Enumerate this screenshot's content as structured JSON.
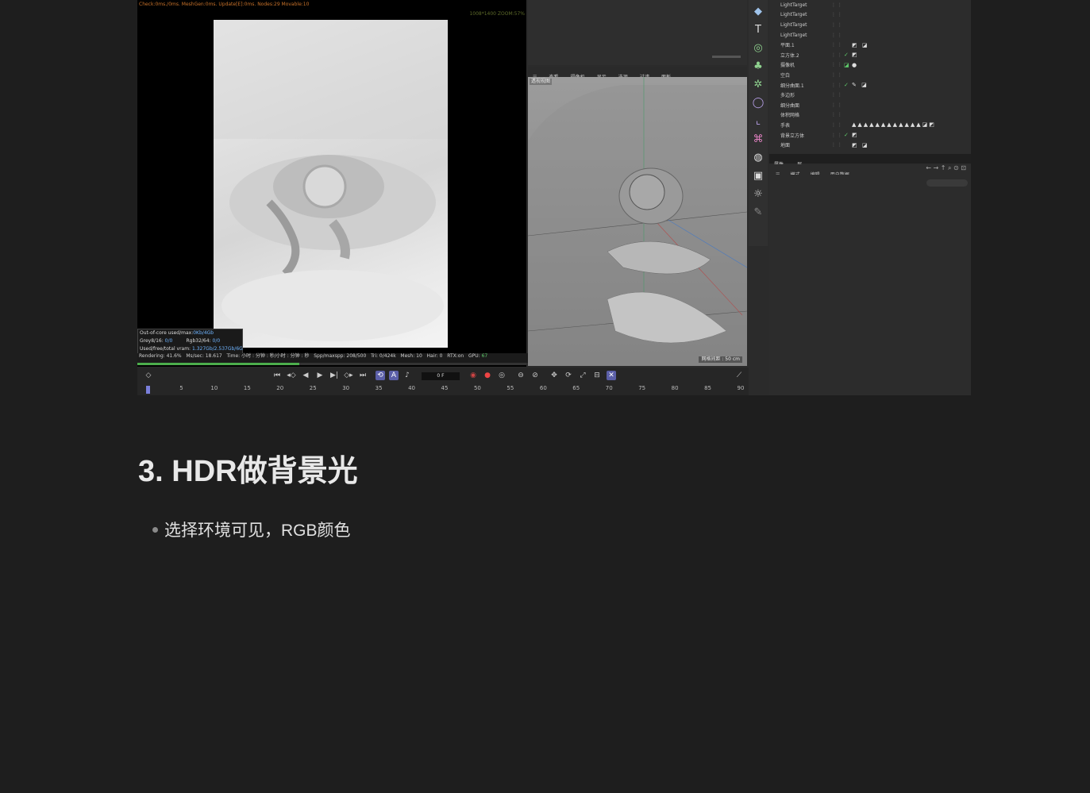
{
  "render_view": {
    "info_line": "Check:0ms./0ms. MeshGen:0ms. Update[E]:0ms. Nodes:29 Movable:10",
    "zoom_line": "1008*1400 ZOOM:57%",
    "stats": [
      {
        "label": "Out-of-core used/max:",
        "value": "0Kb/4Gb"
      },
      {
        "label": "Grey8/16:",
        "value": "0/0",
        "label2": "Rgb32/64:",
        "value2": "0/0"
      },
      {
        "label": "Used/free/total vram:",
        "value": "1.327Gb/2.537Gb/6G"
      }
    ],
    "status": {
      "rendering": "Rendering: 41.6%",
      "ms_sec": "Ms/sec: 18.617",
      "time": "Time: 小时 : 分钟 : 秒/小时 : 分钟 : 秒",
      "spp": "Spp/maxspp: 208/500",
      "tri": "Tri: 0/424k",
      "mesh": "Mesh: 10",
      "hair": "Hair: 0",
      "rtx": "RTX:on",
      "gpu": "GPU:",
      "gpu_val": "67"
    },
    "progress": 0.416
  },
  "viewport": {
    "menu": [
      "查看",
      "摄像机",
      "显示",
      "选项",
      "过滤",
      "面板"
    ],
    "camera_label": "透视视图",
    "scale": "网格间距 : 50 cm"
  },
  "objects": [
    {
      "name": "LightTarget",
      "check": "",
      "tags": ""
    },
    {
      "name": "LightTarget",
      "check": "",
      "tags": ""
    },
    {
      "name": "LightTarget",
      "check": "",
      "tags": ""
    },
    {
      "name": "LightTarget",
      "check": "",
      "tags": ""
    },
    {
      "name": "平面.1",
      "check": "",
      "tags": "◩ ◪"
    },
    {
      "name": "立方体.2",
      "check": "✓",
      "tags": "◩"
    },
    {
      "name": "摄像机",
      "check": "◪",
      "tags": "●"
    },
    {
      "name": "空白",
      "check": "",
      "tags": ""
    },
    {
      "name": "细分曲面.1",
      "check": "✓",
      "tags": "✎ ◪"
    },
    {
      "name": "多边形",
      "check": "",
      "tags": ""
    },
    {
      "name": "细分曲面",
      "check": "",
      "tags": ""
    },
    {
      "name": "体积网格",
      "check": "",
      "tags": ""
    },
    {
      "name": "手表",
      "check": "",
      "tags": "▲▲▲▲▲▲▲▲▲▲▲▲◪◩"
    },
    {
      "name": "背景立方体",
      "check": "✓",
      "tags": "◩"
    },
    {
      "name": "地面",
      "check": "",
      "tags": "◩ ◪"
    }
  ],
  "attributes": {
    "tabs": [
      "属性",
      "层"
    ],
    "menu": [
      "模式",
      "编辑",
      "用户数据"
    ]
  },
  "timeline": {
    "frame": "0 F",
    "ticks": [
      "0",
      "5",
      "10",
      "15",
      "20",
      "25",
      "30",
      "35",
      "40",
      "45",
      "50",
      "55",
      "60",
      "65",
      "70",
      "75",
      "80",
      "85",
      "90"
    ]
  },
  "document": {
    "heading": "3. HDR做背景光",
    "bullet": "选择环境可见，RGB颜色"
  }
}
